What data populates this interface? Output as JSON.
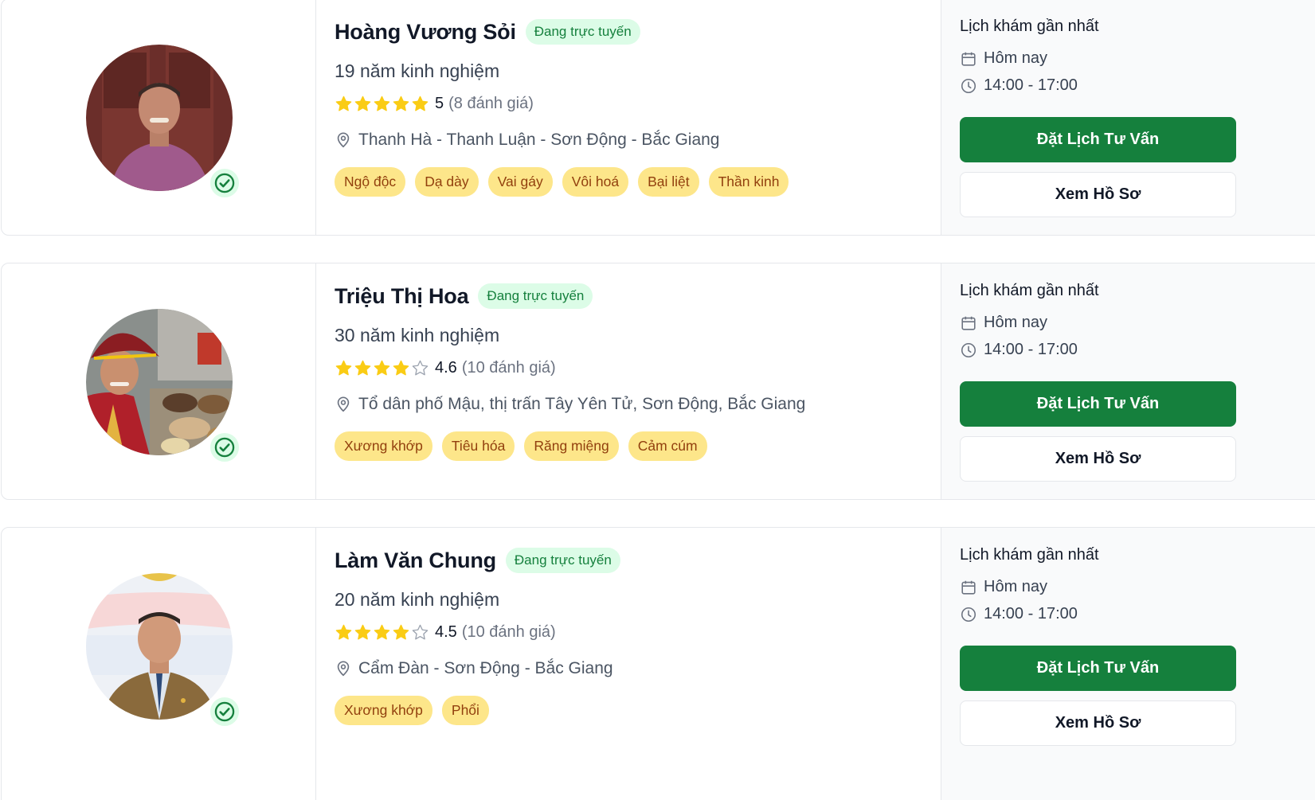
{
  "doctors": [
    {
      "name": "Hoàng Vương Sỏi",
      "status": "Đang trực tuyến",
      "experience": "19 năm kinh nghiệm",
      "rating": {
        "value": "5",
        "count": "(8 đánh giá)",
        "stars_filled": 5
      },
      "location": "Thanh Hà - Thanh Luận - Sơn Động - Bắc Giang",
      "tags": [
        "Ngộ độc",
        "Dạ dày",
        "Vai gáy",
        "Vôi hoá",
        "Bại liệt",
        "Thần kinh"
      ],
      "schedule": {
        "title": "Lịch khám gần nhất",
        "day": "Hôm nay",
        "time": "14:00 - 17:00"
      },
      "book_label": "Đặt Lịch Tư Vấn",
      "profile_label": "Xem Hồ Sơ"
    },
    {
      "name": "Triệu Thị Hoa",
      "status": "Đang trực tuyến",
      "experience": "30 năm kinh nghiệm",
      "rating": {
        "value": "4.6",
        "count": "(10 đánh giá)",
        "stars_filled": 4
      },
      "location": "Tổ dân phố Mậu, thị trấn Tây Yên Tử, Sơn Động, Bắc Giang",
      "tags": [
        "Xương khớp",
        "Tiêu hóa",
        "Răng miệng",
        "Cảm cúm"
      ],
      "schedule": {
        "title": "Lịch khám gần nhất",
        "day": "Hôm nay",
        "time": "14:00 - 17:00"
      },
      "book_label": "Đặt Lịch Tư Vấn",
      "profile_label": "Xem Hồ Sơ"
    },
    {
      "name": "Làm Văn Chung",
      "status": "Đang trực tuyến",
      "experience": "20 năm kinh nghiệm",
      "rating": {
        "value": "4.5",
        "count": "(10 đánh giá)",
        "stars_filled": 4
      },
      "location": "Cẩm Đàn - Sơn Động - Bắc Giang",
      "tags": [
        "Xương khớp",
        "Phổi"
      ],
      "schedule": {
        "title": "Lịch khám gần nhất",
        "day": "Hôm nay",
        "time": "14:00 - 17:00"
      },
      "book_label": "Đặt Lịch Tư Vấn",
      "profile_label": "Xem Hồ Sơ"
    }
  ],
  "colors": {
    "primary_green": "#15803d",
    "online_badge_bg": "#dcfce7",
    "tag_bg": "#fde68a",
    "tag_text": "#92400e",
    "star": "#facc15"
  },
  "icons": {
    "star": "star-icon",
    "location": "map-pin-icon",
    "calendar": "calendar-icon",
    "clock": "clock-icon",
    "verified": "verified-check-icon"
  }
}
